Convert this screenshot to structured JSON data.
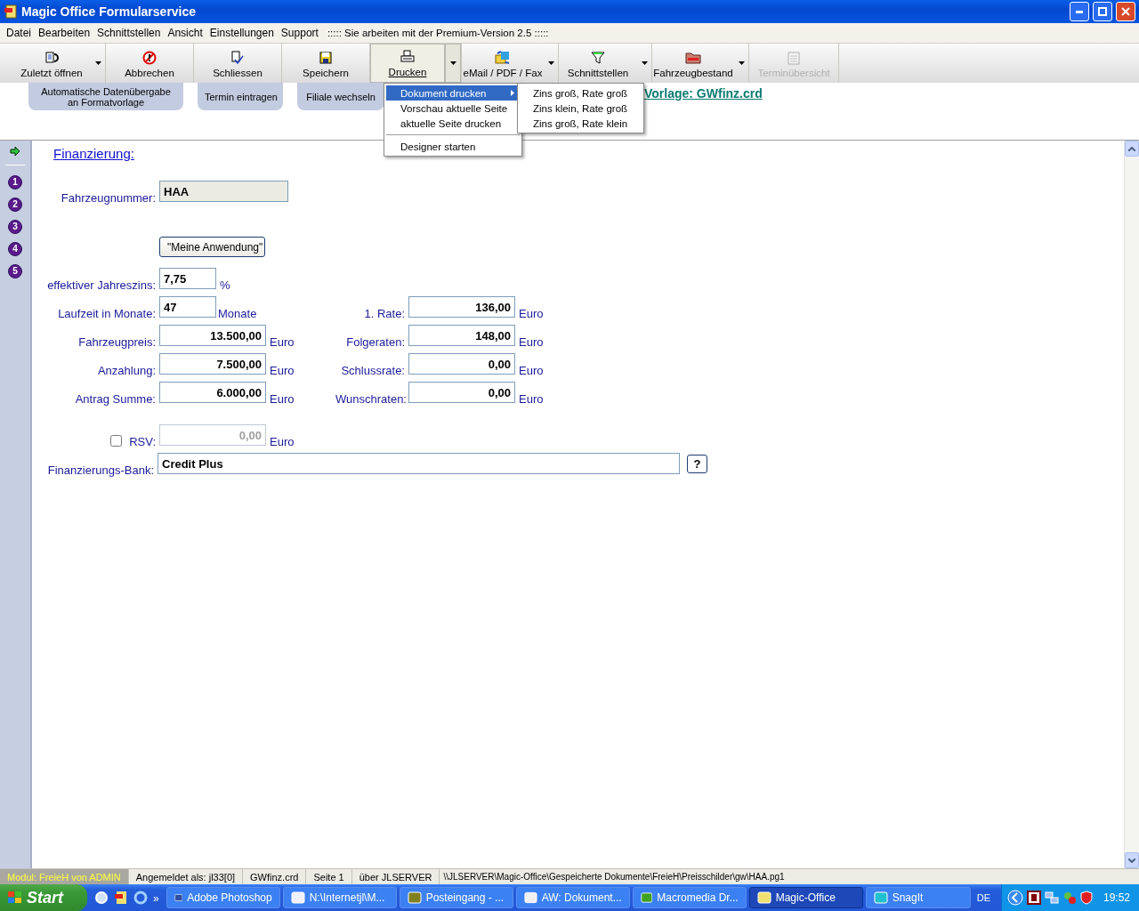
{
  "window": {
    "title": "Magic Office Formularservice"
  },
  "menu": [
    "Datei",
    "Bearbeiten",
    "Schnittstellen",
    "Ansicht",
    "Einstellungen",
    "Support"
  ],
  "version_notice": "::::: Sie arbeiten mit der Premium-Version 2.5 :::::",
  "toolbar": [
    {
      "label": "Zuletzt öffnen",
      "dropdown": true,
      "selected": false,
      "disabled": false
    },
    {
      "label": "Abbrechen",
      "dropdown": false,
      "selected": false,
      "disabled": false
    },
    {
      "label": "Schliessen",
      "dropdown": false,
      "selected": false,
      "disabled": false
    },
    {
      "label": "Speichern",
      "dropdown": false,
      "selected": false,
      "disabled": false
    },
    {
      "label": "Drucken",
      "dropdown": true,
      "selected": true,
      "disabled": false
    },
    {
      "label": "eMail / PDF / Fax",
      "dropdown": true,
      "selected": false,
      "disabled": false
    },
    {
      "label": "Schnittstellen",
      "dropdown": true,
      "selected": false,
      "disabled": false
    },
    {
      "label": "Fahrzeugbestand",
      "dropdown": true,
      "selected": false,
      "disabled": false
    },
    {
      "label": "Terminübersicht",
      "dropdown": false,
      "selected": false,
      "disabled": true
    }
  ],
  "subtabs": [
    "Automatische Datenübergabe an Formatvorlage",
    "Termin eintragen",
    "Filiale wechseln"
  ],
  "template_link": "Vorlage: GWfinz.crd",
  "print_menu": {
    "groups": [
      [
        {
          "label": "Dokument drucken",
          "submenu": true,
          "selected": true
        },
        {
          "label": "Vorschau aktuelle Seite",
          "submenu": false,
          "selected": false
        },
        {
          "label": "aktuelle Seite drucken",
          "submenu": false,
          "selected": false
        }
      ],
      [
        {
          "label": "Designer starten",
          "submenu": false,
          "selected": false
        }
      ]
    ],
    "submenu": [
      "Zins groß, Rate groß",
      "Zins klein, Rate groß",
      "Zins groß, Rate klein"
    ]
  },
  "side_nav": [
    "1",
    "2",
    "3",
    "4",
    "5"
  ],
  "form": {
    "title": "Finanzierung:",
    "vehicle_number": {
      "label": "Fahrzeugnummer:",
      "value": "HAA"
    },
    "app_button": "\"Meine Anwendung\"",
    "interest": {
      "label": "effektiver Jahreszins:",
      "value": "7,75",
      "unit": "%"
    },
    "term": {
      "label": "Laufzeit in Monate:",
      "value": "47",
      "unit": "Monate"
    },
    "left_fields": [
      {
        "label": "Fahrzeugpreis:",
        "value": "13.500,00",
        "unit": "Euro"
      },
      {
        "label": "Anzahlung:",
        "value": "7.500,00",
        "unit": "Euro"
      },
      {
        "label": "Antrag Summe:",
        "value": "6.000,00",
        "unit": "Euro"
      }
    ],
    "right_fields": [
      {
        "label": "1. Rate:",
        "value": "136,00",
        "unit": "Euro"
      },
      {
        "label": "Folgeraten:",
        "value": "148,00",
        "unit": "Euro"
      },
      {
        "label": "Schlussrate:",
        "value": "0,00",
        "unit": "Euro"
      },
      {
        "label": "Wunschraten:",
        "value": "0,00",
        "unit": "Euro"
      }
    ],
    "rsv": {
      "label": "RSV:",
      "checked": false,
      "value": "0,00",
      "unit": "Euro",
      "disabled": true
    },
    "bank": {
      "label": "Finanzierungs-Bank:",
      "value": "Credit Plus",
      "button": "?"
    }
  },
  "status_bar": [
    {
      "text": "Modul: FreieH von ADMIN",
      "kind": "module"
    },
    {
      "text": "Angemeldet als: jl33[0]",
      "kind": "plain"
    },
    {
      "text": "GWfinz.crd",
      "kind": "plain"
    },
    {
      "text": "Seite 1",
      "kind": "plain"
    },
    {
      "text": "über JLSERVER",
      "kind": "plain"
    },
    {
      "text": "\\\\JLSERVER\\Magic-Office\\Gespeicherte Dokumente\\FreieH\\Preisschilder\\gw\\HAA.pg1",
      "kind": "path"
    }
  ],
  "taskbar": {
    "start": "Start",
    "quick_more": "»",
    "tasks": [
      {
        "label": "Adobe Photoshop",
        "selected": false
      },
      {
        "label": "N:\\Internetjl\\M...",
        "selected": false
      },
      {
        "label": "Posteingang - ...",
        "selected": false
      },
      {
        "label": "AW: Dokument...",
        "selected": false
      },
      {
        "label": "Macromedia Dr...",
        "selected": false
      },
      {
        "label": "Magic-Office",
        "selected": true
      },
      {
        "label": "SnagIt",
        "selected": false
      }
    ],
    "language": "DE",
    "clock": "19:52"
  }
}
